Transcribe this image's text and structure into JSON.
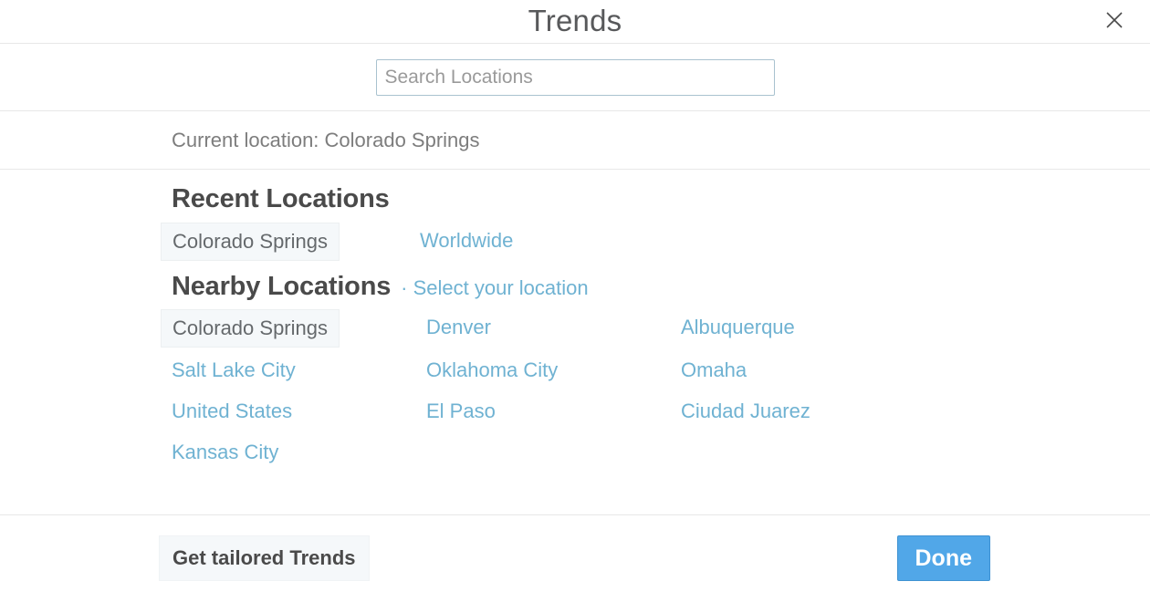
{
  "header": {
    "title": "Trends",
    "close_label": "X"
  },
  "search": {
    "placeholder": "Search Locations",
    "value": ""
  },
  "current_location": {
    "text": "Current location: Colorado Springs"
  },
  "recent": {
    "title": "Recent Locations",
    "items": [
      {
        "label": "Colorado Springs",
        "selected": true
      },
      {
        "label": "Worldwide",
        "selected": false
      }
    ]
  },
  "nearby": {
    "title": "Nearby Locations",
    "subtitle": "· Select your location",
    "rows": [
      [
        {
          "label": "Colorado Springs",
          "selected": true
        },
        {
          "label": "Denver",
          "selected": false
        },
        {
          "label": "Albuquerque",
          "selected": false
        }
      ],
      [
        {
          "label": "Salt Lake City",
          "selected": false
        },
        {
          "label": "Oklahoma City",
          "selected": false
        },
        {
          "label": "Omaha",
          "selected": false
        }
      ],
      [
        {
          "label": "United States",
          "selected": false
        },
        {
          "label": "El Paso",
          "selected": false
        },
        {
          "label": "Ciudad Juarez",
          "selected": false
        }
      ],
      [
        {
          "label": "Kansas City",
          "selected": false
        }
      ]
    ]
  },
  "footer": {
    "tailored_label": "Get tailored Trends",
    "done_label": "Done"
  },
  "colors": {
    "link_blue": "#6fb2d2",
    "done_blue": "#51a7e8",
    "chip_background": "#f5f8fa",
    "heading_gray": "#4a4a4a",
    "muted_gray": "#7d7d7d",
    "divider": "#e8e8e8"
  }
}
